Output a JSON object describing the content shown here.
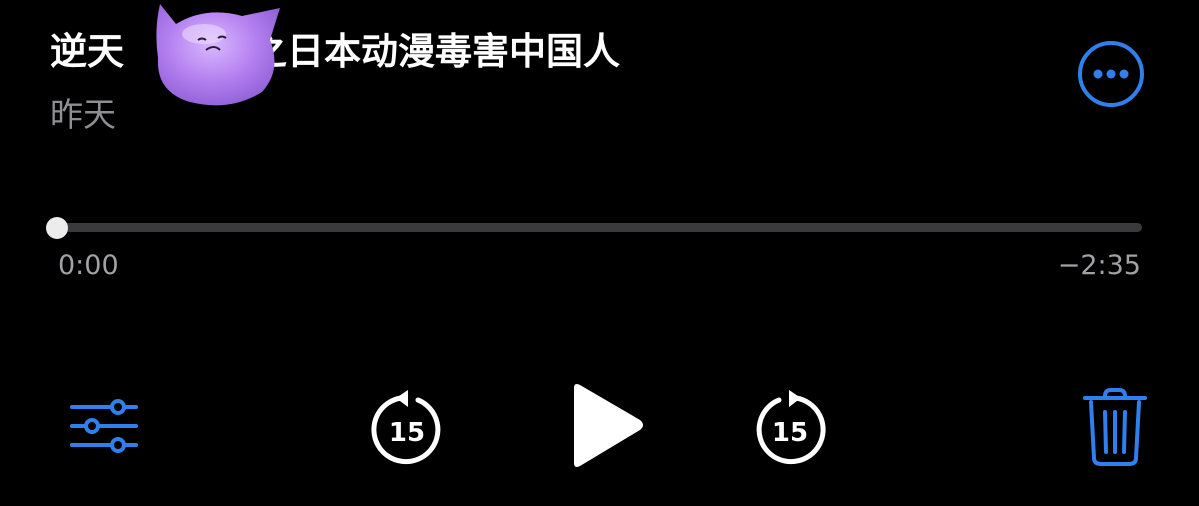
{
  "recording": {
    "title_part1": "逆天",
    "title_part2": "之日本动漫毒害中国人",
    "date": "昨天"
  },
  "playback": {
    "elapsed": "0:00",
    "remaining": "−2:35",
    "progress_fraction": 0.0,
    "skip_back_seconds": "15",
    "skip_forward_seconds": "15"
  },
  "icons": {
    "more": "ellipsis-circle-icon",
    "edit": "sliders-icon",
    "skip_back": "gobackward-15-icon",
    "play": "play-icon",
    "skip_forward": "goforward-15-icon",
    "trash": "trash-icon",
    "sticker": "purple-blob-sticker"
  },
  "colors": {
    "accent": "#2f80ed",
    "background": "#000000",
    "secondary_text": "#8e8e93",
    "sticker": "#b884f2"
  }
}
